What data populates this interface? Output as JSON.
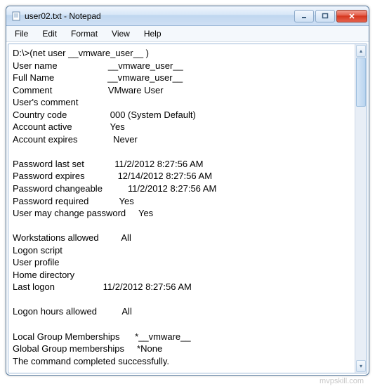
{
  "window": {
    "title": "user02.txt - Notepad"
  },
  "menubar": {
    "file": "File",
    "edit": "Edit",
    "format": "Format",
    "view": "View",
    "help": "Help"
  },
  "body": {
    "cmd_line": "D:\\>(net user __vmware_user__ )",
    "user_name_lbl": "User name",
    "user_name_val": "__vmware_user__",
    "full_name_lbl": "Full Name",
    "full_name_val": "__vmware_user__",
    "comment_lbl": "Comment",
    "comment_val": "VMware User",
    "users_comment_lbl": "User's comment",
    "country_lbl": "Country code",
    "country_val": "000 (System Default)",
    "active_lbl": "Account active",
    "active_val": "Yes",
    "expires_lbl": "Account expires",
    "expires_val": "Never",
    "pw_set_lbl": "Password last set",
    "pw_set_val": "11/2/2012 8:27:56 AM",
    "pw_exp_lbl": "Password expires",
    "pw_exp_val": "12/14/2012 8:27:56 AM",
    "pw_chg_lbl": "Password changeable",
    "pw_chg_val": "11/2/2012 8:27:56 AM",
    "pw_req_lbl": "Password required",
    "pw_req_val": "Yes",
    "pw_may_lbl": "User may change password",
    "pw_may_val": "Yes",
    "ws_lbl": "Workstations allowed",
    "ws_val": "All",
    "logon_script_lbl": "Logon script",
    "user_profile_lbl": "User profile",
    "home_dir_lbl": "Home directory",
    "last_logon_lbl": "Last logon",
    "last_logon_val": "11/2/2012 8:27:56 AM",
    "hours_lbl": "Logon hours allowed",
    "hours_val": "All",
    "local_grp_lbl": "Local Group Memberships",
    "local_grp_val": "*__vmware__",
    "global_grp_lbl": "Global Group memberships",
    "global_grp_val": "*None",
    "completed": "The command completed successfully."
  },
  "watermark": "mvpskill.com"
}
